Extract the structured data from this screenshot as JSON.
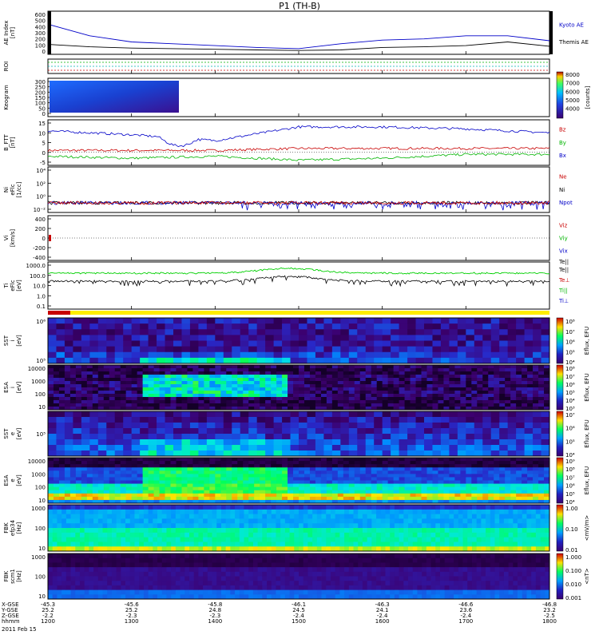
{
  "title": "P1  (TH-B)",
  "panels": [
    {
      "id": "ae",
      "ylabel": [
        "AE Index",
        "[nT]"
      ],
      "yticks": [
        "600",
        "500",
        "400",
        "300",
        "200",
        "100",
        "0"
      ],
      "legend": [
        {
          "text": "Kyoto AE",
          "color": "#0000c8"
        },
        {
          "text": "Themis AE",
          "color": "#000000"
        }
      ]
    },
    {
      "id": "roi",
      "ylabel": [
        "ROI"
      ],
      "yticks": [],
      "legend": []
    },
    {
      "id": "keogram",
      "ylabel": [
        "Keogram"
      ],
      "yticks": [
        "300",
        "250",
        "200",
        "150",
        "100",
        "50",
        "0"
      ],
      "colorbar": {
        "labels": [
          "8000",
          "7000",
          "6000",
          "5000",
          "4000"
        ],
        "title": "[counts]"
      },
      "legend": []
    },
    {
      "id": "bfield",
      "ylabel": [
        "B_FTT",
        "[nT]"
      ],
      "yticks": [
        "15",
        "10",
        "5",
        "0",
        "-5"
      ],
      "legend": [
        {
          "text": "Bz",
          "color": "#c80000"
        },
        {
          "text": "By",
          "color": "#00b400"
        },
        {
          "text": "Bx",
          "color": "#0000c8"
        }
      ]
    },
    {
      "id": "density",
      "ylabel": [
        "Ni",
        "eFlc",
        "[1/cc]"
      ],
      "yticks": [
        "10⁴",
        "10²",
        "10⁰",
        "10⁻²"
      ],
      "legend": [
        {
          "text": "Ne",
          "color": "#c80000"
        },
        {
          "text": "Ni",
          "color": "#000000"
        },
        {
          "text": "Npot",
          "color": "#0000c8"
        }
      ]
    },
    {
      "id": "velocity",
      "ylabel": [
        "Vi",
        "[km/s]"
      ],
      "yticks": [
        "400",
        "200",
        "0",
        "-200",
        "-400"
      ],
      "legend": [
        {
          "text": "Viz",
          "color": "#c80000"
        },
        {
          "text": "Viy",
          "color": "#00b400"
        },
        {
          "text": "Vix",
          "color": "#0000c8"
        }
      ]
    },
    {
      "id": "temp",
      "ylabel": [
        "Ti",
        "eFlc",
        "[eV]"
      ],
      "yticks": [
        "1000.0",
        "100.0",
        "10.0",
        "1.0",
        "0.1"
      ],
      "legend": [
        {
          "text": "Te||",
          "color": "#000000"
        },
        {
          "text": "Te⊥",
          "color": "#c80000"
        },
        {
          "text": "Ti||",
          "color": "#00b400"
        },
        {
          "text": "Ti⊥",
          "color": "#0000c8"
        }
      ]
    },
    {
      "id": "sst_i",
      "ylabel": [
        "SST",
        "i",
        "[eV]"
      ],
      "yticks": [
        "10⁶",
        "10⁵"
      ],
      "cb_labels": [
        "10⁸",
        "10⁷",
        "10⁶",
        "10⁵",
        "10⁴"
      ],
      "cb_title": "Eflux, EFU"
    },
    {
      "id": "esa_i",
      "ylabel": [
        "ESA",
        "i",
        "[eV]"
      ],
      "yticks": [
        "10000",
        "1000",
        "100",
        "10"
      ],
      "cb_labels": [
        "10⁸",
        "10⁷",
        "10⁶",
        "10⁵",
        "10⁴",
        "10³"
      ],
      "cb_title": "Eflux, EFU"
    },
    {
      "id": "sst_e",
      "ylabel": [
        "SST",
        "e",
        "[eV]"
      ],
      "yticks": [
        "10⁵"
      ],
      "cb_labels": [
        "10⁷",
        "10⁶",
        "10⁵",
        "10⁴"
      ],
      "cb_title": "Eflux, EFU"
    },
    {
      "id": "esa_e",
      "ylabel": [
        "ESA",
        "e",
        "[eV]"
      ],
      "yticks": [
        "10000",
        "1000",
        "100",
        "10"
      ],
      "cb_labels": [
        "10⁹",
        "10⁸",
        "10⁷",
        "10⁶",
        "10⁵",
        "10⁴"
      ],
      "cb_title": "Eflux, EFU"
    },
    {
      "id": "fbk_e",
      "ylabel": [
        "FBK",
        "efp34",
        "[Hz]"
      ],
      "yticks": [
        "1000",
        "100",
        "10"
      ],
      "cb_labels": [
        "1.00",
        "0.10",
        "0.01"
      ],
      "cb_title": "<mV/m>"
    },
    {
      "id": "fbk_b",
      "ylabel": [
        "FBK",
        "scm1",
        "[Hz]"
      ],
      "yticks": [
        "1000",
        "100",
        "10"
      ],
      "cb_labels": [
        "1.000",
        "0.100",
        "0.010",
        "0.001"
      ],
      "cb_title": "<nT>"
    }
  ],
  "footer": {
    "row_labels": [
      "X-GSE",
      "Y-GSE",
      "Z-GSE",
      "hhmm",
      "2011 Feb 15"
    ],
    "columns": [
      {
        "x": "-45.3",
        "y": "25.2",
        "z": "-2.2",
        "t": "1200"
      },
      {
        "x": "-45.6",
        "y": "25.2",
        "z": "-2.3",
        "t": "1300"
      },
      {
        "x": "-45.8",
        "y": "24.8",
        "z": "-2.3",
        "t": "1400"
      },
      {
        "x": "-46.1",
        "y": "24.5",
        "z": "-2.4",
        "t": "1500"
      },
      {
        "x": "-46.3",
        "y": "24.1",
        "z": "-2.4",
        "t": "1600"
      },
      {
        "x": "-46.6",
        "y": "23.6",
        "z": "-2.4",
        "t": "1700"
      },
      {
        "x": "-46.8",
        "y": "23.2",
        "z": "-2.5",
        "t": "1800"
      }
    ]
  },
  "chart_data": {
    "type": "line",
    "title": "P1  (TH-B)",
    "x_tick_labels": [
      "1200",
      "1300",
      "1400",
      "1500",
      "1600",
      "1700",
      "1800"
    ],
    "xlabel": "hhmm",
    "series": [
      {
        "name": "Kyoto AE",
        "panel": "ae",
        "color": "#0000c8",
        "x": [
          "1200",
          "1230",
          "1300",
          "1330",
          "1400",
          "1430",
          "1500",
          "1530",
          "1600",
          "1630",
          "1700",
          "1730",
          "1800"
        ],
        "values": [
          440,
          250,
          150,
          120,
          90,
          60,
          40,
          120,
          180,
          200,
          250,
          250,
          170
        ]
      },
      {
        "name": "Themis AE",
        "panel": "ae",
        "color": "#000000",
        "x": [
          "1200",
          "1230",
          "1300",
          "1330",
          "1400",
          "1430",
          "1500",
          "1530",
          "1600",
          "1630",
          "1700",
          "1730",
          "1800"
        ],
        "values": [
          110,
          70,
          50,
          40,
          30,
          20,
          10,
          20,
          60,
          70,
          90,
          150,
          80
        ]
      },
      {
        "name": "Bz",
        "panel": "bfield",
        "color": "#c80000",
        "x": [
          "1200",
          "1300",
          "1400",
          "1500",
          "1600",
          "1700",
          "1800"
        ],
        "values": [
          1,
          1,
          1,
          2,
          2,
          2,
          2
        ]
      },
      {
        "name": "By",
        "panel": "bfield",
        "color": "#00b400",
        "x": [
          "1200",
          "1300",
          "1400",
          "1500",
          "1600",
          "1700",
          "1800"
        ],
        "values": [
          -2,
          -3,
          -2,
          -4,
          -3,
          -1,
          -1
        ]
      },
      {
        "name": "Bx",
        "panel": "bfield",
        "color": "#0000c8",
        "x": [
          "1200",
          "1300",
          "1400",
          "1500",
          "1600",
          "1700",
          "1800"
        ],
        "values": [
          11,
          9,
          6,
          13,
          13,
          12,
          10
        ]
      }
    ],
    "colors": {
      "kyoto": "#0000c8",
      "themis": "#000000",
      "bz": "#c80000",
      "by": "#00b400",
      "bx": "#0000c8"
    }
  }
}
